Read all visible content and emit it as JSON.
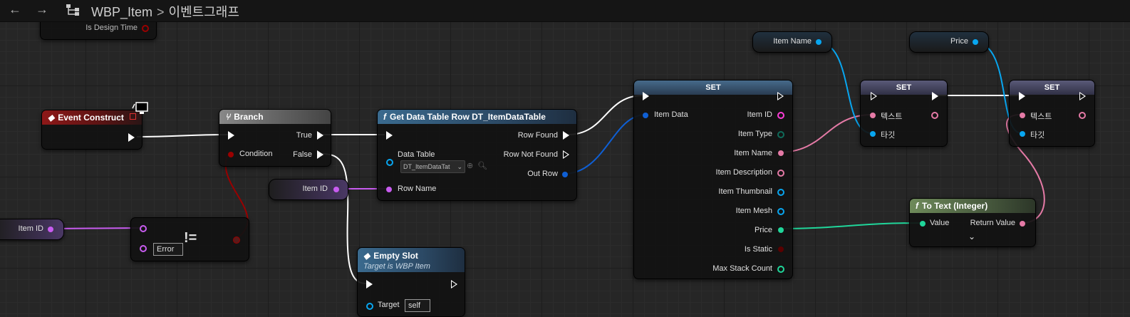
{
  "toolbar": {
    "back_icon": "arrow-left-icon",
    "forward_icon": "arrow-right-icon",
    "tree_icon": "blueprint-tree-icon"
  },
  "breadcrumb": {
    "blueprint": "WBP_Item",
    "separator": ">",
    "graph": "이벤트그래프"
  },
  "nodes": {
    "design_time": {
      "pin": "Is Design Time"
    },
    "event_construct": {
      "title": "Event Construct"
    },
    "branch": {
      "title": "Branch",
      "condition": "Condition",
      "true": "True",
      "false": "False"
    },
    "get_row": {
      "title": "Get Data Table Row DT_ItemDataTable",
      "data_table": "Data Table",
      "data_table_value": "DT_ItemDataTat",
      "row_name": "Row Name",
      "row_found": "Row Found",
      "row_not_found": "Row Not Found",
      "out_row": "Out Row"
    },
    "item_id_var1": {
      "label": "Item ID"
    },
    "item_id_var2": {
      "label": "Item ID"
    },
    "not_equal": {
      "operator": "!=",
      "input_value": "Error"
    },
    "empty_slot": {
      "title": "Empty Slot",
      "subtitle": "Target is WBP Item",
      "target": "Target",
      "target_value": "self"
    },
    "set_struct": {
      "title": "SET",
      "input": "Item Data",
      "outputs": [
        "Item ID",
        "Item Type",
        "Item Name",
        "Item Description",
        "Item Thumbnail",
        "Item Mesh",
        "Price",
        "Is Static",
        "Max Stack Count"
      ]
    },
    "item_name_var": {
      "label": "Item Name"
    },
    "price_var": {
      "label": "Price"
    },
    "set_text1": {
      "title": "SET",
      "text": "텍스트",
      "target": "타깃"
    },
    "set_text2": {
      "title": "SET",
      "text": "텍스트",
      "target": "타깃"
    },
    "to_text": {
      "title": "To Text (Integer)",
      "value": "Value",
      "return": "Return Value"
    }
  },
  "colors": {
    "exec": "#ffffff",
    "bool": "#9a0000",
    "name": "#c85cf0",
    "struct": "#0f5fd4",
    "text": "#e57aa6",
    "int": "#20d69a",
    "object": "#08a6f0",
    "string": "#ff3dd8"
  }
}
